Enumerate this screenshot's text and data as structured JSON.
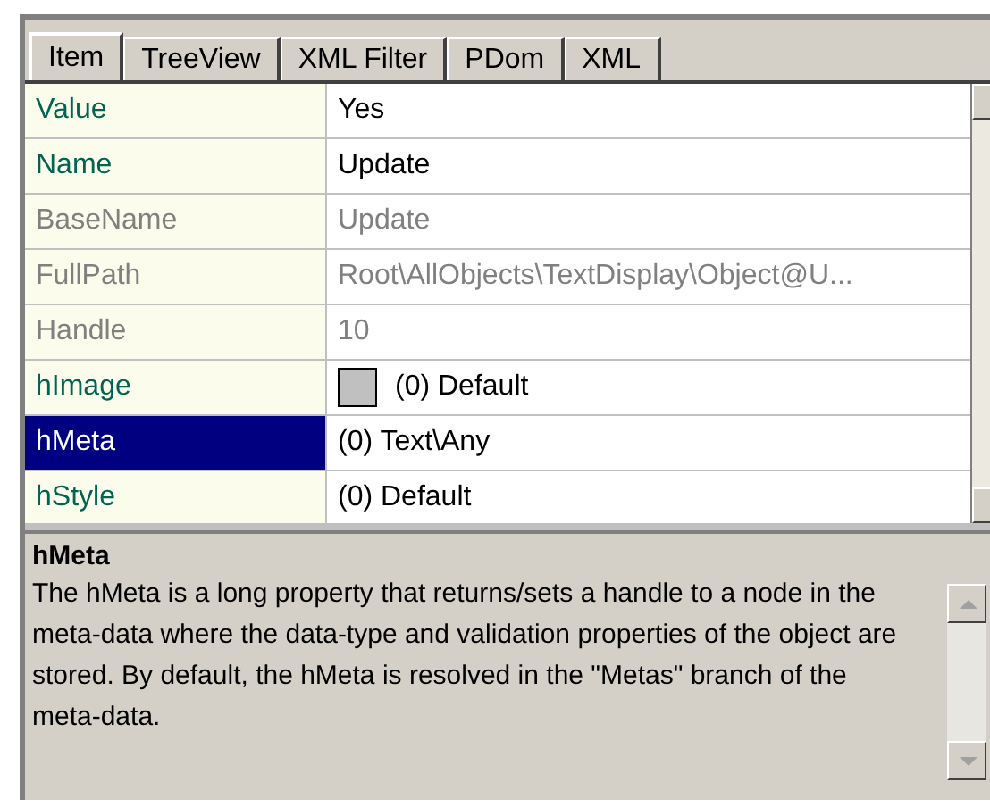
{
  "tabs": [
    {
      "label": "Item",
      "selected": true
    },
    {
      "label": "TreeView",
      "selected": false
    },
    {
      "label": "XML Filter",
      "selected": false
    },
    {
      "label": "PDom",
      "selected": false
    },
    {
      "label": "XML",
      "selected": false
    }
  ],
  "properties": [
    {
      "name": "Value",
      "value": "Yes",
      "disabled": false,
      "selected": false
    },
    {
      "name": "Name",
      "value": "Update",
      "disabled": false,
      "selected": false
    },
    {
      "name": "BaseName",
      "value": "Update",
      "disabled": true,
      "selected": false
    },
    {
      "name": "FullPath",
      "value": "Root\\AllObjects\\TextDisplay\\Object@U...",
      "disabled": true,
      "selected": false
    },
    {
      "name": "Handle",
      "value": "10",
      "disabled": true,
      "selected": false
    },
    {
      "name": "hImage",
      "value": "(0) Default",
      "disabled": false,
      "selected": false,
      "kind": "swatch"
    },
    {
      "name": "hMeta",
      "value": "(0) Text\\Any",
      "disabled": false,
      "selected": true
    },
    {
      "name": "hStyle",
      "value": "(0) Default",
      "disabled": false,
      "selected": false
    }
  ],
  "description": {
    "title": "hMeta",
    "text": "The hMeta is a long property that returns/sets a handle to a node in the meta-data where the data-type and validation properties of the object are stored. By default, the hMeta is resolved in the \"Metas\" branch of the meta-data."
  }
}
